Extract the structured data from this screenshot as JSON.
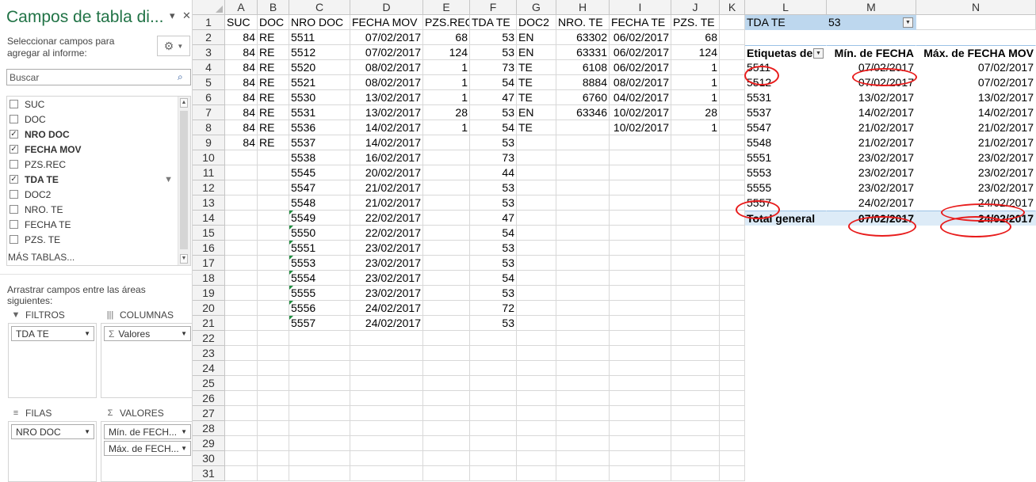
{
  "pane": {
    "title": "Campos de tabla di...",
    "pin_icon": "▾",
    "close_icon": "✕",
    "description": "Seleccionar campos para agregar al informe:",
    "gear_icon": "⚙",
    "search_placeholder": "Buscar",
    "fields": [
      {
        "label": "SUC",
        "checked": false
      },
      {
        "label": "DOC",
        "checked": false
      },
      {
        "label": "NRO DOC",
        "checked": true
      },
      {
        "label": "FECHA MOV",
        "checked": true
      },
      {
        "label": "PZS.REC",
        "checked": false
      },
      {
        "label": "TDA TE",
        "checked": true,
        "filtered": true
      },
      {
        "label": "DOC2",
        "checked": false
      },
      {
        "label": "NRO. TE",
        "checked": false
      },
      {
        "label": "FECHA TE",
        "checked": false
      },
      {
        "label": "PZS. TE",
        "checked": false
      }
    ],
    "more_tables": "MÁS TABLAS...",
    "drag_hint": "Arrastrar campos entre las áreas siguientes:",
    "areas": {
      "filters": {
        "label": "FILTROS",
        "items": [
          "TDA TE"
        ]
      },
      "columns": {
        "label": "COLUMNAS",
        "items": [
          "Valores"
        ]
      },
      "rows": {
        "label": "FILAS",
        "items": [
          "NRO DOC"
        ]
      },
      "values": {
        "label": "VALORES",
        "items": [
          "Mín. de FECH...",
          "Máx. de FECH..."
        ]
      }
    }
  },
  "sheet": {
    "columns": [
      "A",
      "B",
      "C",
      "D",
      "E",
      "F",
      "G",
      "H",
      "I",
      "J",
      "K",
      "L",
      "M",
      "N"
    ],
    "row_numbers": [
      "1",
      "2",
      "3",
      "4",
      "5",
      "6",
      "7",
      "8",
      "9",
      "10",
      "11",
      "12",
      "13",
      "14",
      "15",
      "16",
      "17",
      "18",
      "19",
      "20",
      "21",
      "22",
      "23",
      "24",
      "25",
      "26",
      "27",
      "28",
      "29",
      "30",
      "31"
    ],
    "headers": [
      "SUC",
      "DOC",
      "NRO DOC",
      "FECHA MOV",
      "PZS.REC",
      "TDA TE",
      "DOC2",
      "NRO. TE",
      "FECHA TE",
      "PZS. TE"
    ],
    "rows": [
      [
        "84",
        "RE",
        "5511",
        "07/02/2017",
        "68",
        "53",
        "EN",
        "63302",
        "06/02/2017",
        "68"
      ],
      [
        "84",
        "RE",
        "5512",
        "07/02/2017",
        "124",
        "53",
        "EN",
        "63331",
        "06/02/2017",
        "124"
      ],
      [
        "84",
        "RE",
        "5520",
        "08/02/2017",
        "1",
        "73",
        "TE",
        "6108",
        "06/02/2017",
        "1"
      ],
      [
        "84",
        "RE",
        "5521",
        "08/02/2017",
        "1",
        "54",
        "TE",
        "8884",
        "08/02/2017",
        "1"
      ],
      [
        "84",
        "RE",
        "5530",
        "13/02/2017",
        "1",
        "47",
        "TE",
        "6760",
        "04/02/2017",
        "1"
      ],
      [
        "84",
        "RE",
        "5531",
        "13/02/2017",
        "28",
        "53",
        "EN",
        "63346",
        "10/02/2017",
        "28"
      ],
      [
        "84",
        "RE",
        "5536",
        "14/02/2017",
        "1",
        "54",
        "TE",
        "",
        "10/02/2017",
        "1"
      ],
      [
        "84",
        "RE",
        "5537",
        "14/02/2017",
        "",
        "53",
        "",
        "",
        "",
        ""
      ],
      [
        "",
        "",
        "5538",
        "16/02/2017",
        "",
        "73",
        "",
        "",
        "",
        ""
      ],
      [
        "",
        "",
        "5545",
        "20/02/2017",
        "",
        "44",
        "",
        "",
        "",
        ""
      ],
      [
        "",
        "",
        "5547",
        "21/02/2017",
        "",
        "53",
        "",
        "",
        "",
        ""
      ],
      [
        "",
        "",
        "5548",
        "21/02/2017",
        "",
        "53",
        "",
        "",
        "",
        ""
      ],
      [
        "",
        "",
        "5549",
        "22/02/2017",
        "",
        "47",
        "",
        "",
        "",
        ""
      ],
      [
        "",
        "",
        "5550",
        "22/02/2017",
        "",
        "54",
        "",
        "",
        "",
        ""
      ],
      [
        "",
        "",
        "5551",
        "23/02/2017",
        "",
        "53",
        "",
        "",
        "",
        ""
      ],
      [
        "",
        "",
        "5553",
        "23/02/2017",
        "",
        "53",
        "",
        "",
        "",
        ""
      ],
      [
        "",
        "",
        "5554",
        "23/02/2017",
        "",
        "54",
        "",
        "",
        "",
        ""
      ],
      [
        "",
        "",
        "5555",
        "23/02/2017",
        "",
        "53",
        "",
        "",
        "",
        ""
      ],
      [
        "",
        "",
        "5556",
        "24/02/2017",
        "",
        "72",
        "",
        "",
        "",
        ""
      ],
      [
        "",
        "",
        "5557",
        "24/02/2017",
        "",
        "53",
        "",
        "",
        "",
        ""
      ]
    ],
    "green_triangle_rows": [
      12,
      13,
      14,
      15,
      16,
      17,
      18,
      19
    ]
  },
  "pivot": {
    "filter_label": "TDA TE",
    "filter_value": "53",
    "headers": [
      "Etiquetas de",
      "Mín. de FECHA",
      "Máx. de FECHA MOV"
    ],
    "rows": [
      [
        "5511",
        "07/02/2017",
        "07/02/2017"
      ],
      [
        "5512",
        "07/02/2017",
        "07/02/2017"
      ],
      [
        "5531",
        "13/02/2017",
        "13/02/2017"
      ],
      [
        "5537",
        "14/02/2017",
        "14/02/2017"
      ],
      [
        "5547",
        "21/02/2017",
        "21/02/2017"
      ],
      [
        "5548",
        "21/02/2017",
        "21/02/2017"
      ],
      [
        "5551",
        "23/02/2017",
        "23/02/2017"
      ],
      [
        "5553",
        "23/02/2017",
        "23/02/2017"
      ],
      [
        "5555",
        "23/02/2017",
        "23/02/2017"
      ],
      [
        "5557",
        "24/02/2017",
        "24/02/2017"
      ]
    ],
    "total": [
      "Total general",
      "07/02/2017",
      "24/02/2017"
    ]
  },
  "colors": {
    "pane_title": "#217346",
    "pivot_filter_fill": "#bdd7ee",
    "pivot_total_fill": "#ddebf7",
    "annotation": "#e81c1c"
  }
}
